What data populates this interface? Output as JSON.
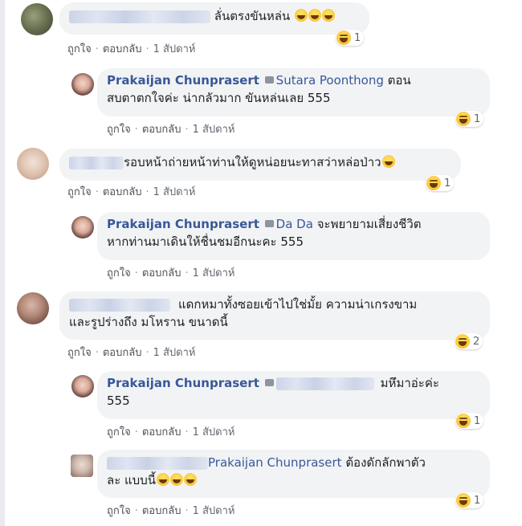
{
  "actions": {
    "like": "ถูกใจ",
    "reply": "ตอบกลับ",
    "time": "1 สัปดาห์"
  },
  "comments": [
    {
      "text": "ลั่นตรงขันหล่น",
      "reaction_count": "1"
    },
    {
      "author": "Prakaijan Chunprasert",
      "mention": "Sutara Poonthong",
      "text_line1": "ตอน",
      "text_line2": "สบตาตกใจค่ะ น่ากลัวมาก ขันหล่นเลย 555",
      "reaction_count": "1"
    },
    {
      "text": "รอบหน้าถ่ายหน้าท่านให้ดูหน่อยนะทาสว่าหล่อป่าว",
      "reaction_count": "1"
    },
    {
      "author": "Prakaijan Chunprasert",
      "mention": "Da Da",
      "text_line1": "จะพยายามเสี่ยงชีวิต",
      "text_line2": "หากท่านมาเดินให้ชื่นชมอีกนะคะ 555"
    },
    {
      "text_line1": "แดกหมาทั้งซอยเข้าไปใช่มั้ย ความน่าเกรงขาม",
      "text_line2": "และรูปร่างถึง มโหราน ขนาดนี้",
      "reaction_count": "2"
    },
    {
      "author": "Prakaijan Chunprasert",
      "text_line1": "มหึมาอ่ะค่ะ",
      "text_line2": "555",
      "reaction_count": "1"
    },
    {
      "mention": "Prakaijan Chunprasert",
      "text_line1": "ต้องดักลักพาตัว",
      "text_line2": "ละ แบบนี้",
      "reaction_count": "1"
    }
  ],
  "colors": {
    "bubble": "#f2f3f5",
    "name": "#385898",
    "meta": "#606770"
  },
  "icons": [
    "haha-reaction-icon",
    "messenger-icon",
    "laughing-emoji-icon"
  ]
}
